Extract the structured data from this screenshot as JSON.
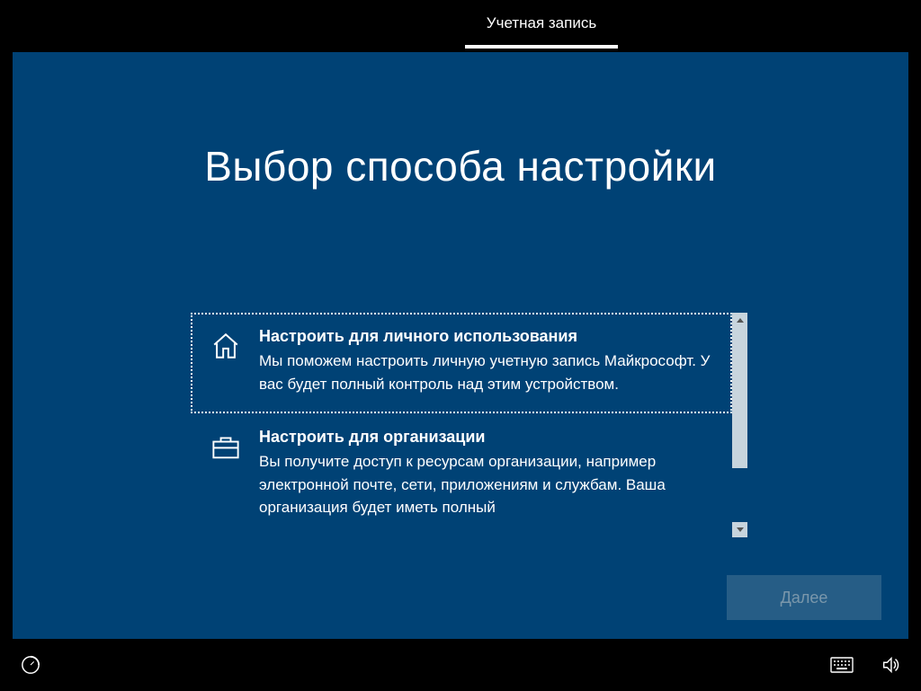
{
  "topbar": {
    "tab_label": "Учетная запись"
  },
  "heading": "Выбор способа настройки",
  "options": [
    {
      "icon": "home-icon",
      "title": "Настроить для личного использования",
      "description": "Мы поможем настроить личную учетную запись Майкрософт. У вас будет полный контроль над этим устройством.",
      "selected": true
    },
    {
      "icon": "briefcase-icon",
      "title": "Настроить для организации",
      "description": "Вы получите доступ к ресурсам организации, например электронной почте, сети, приложениям и службам. Ваша организация будет иметь полный",
      "selected": false
    }
  ],
  "next_button": "Далее",
  "bottombar": {
    "ease_of_access": "Специальные возможности",
    "keyboard": "Экранная клавиатура",
    "volume": "Громкость"
  }
}
